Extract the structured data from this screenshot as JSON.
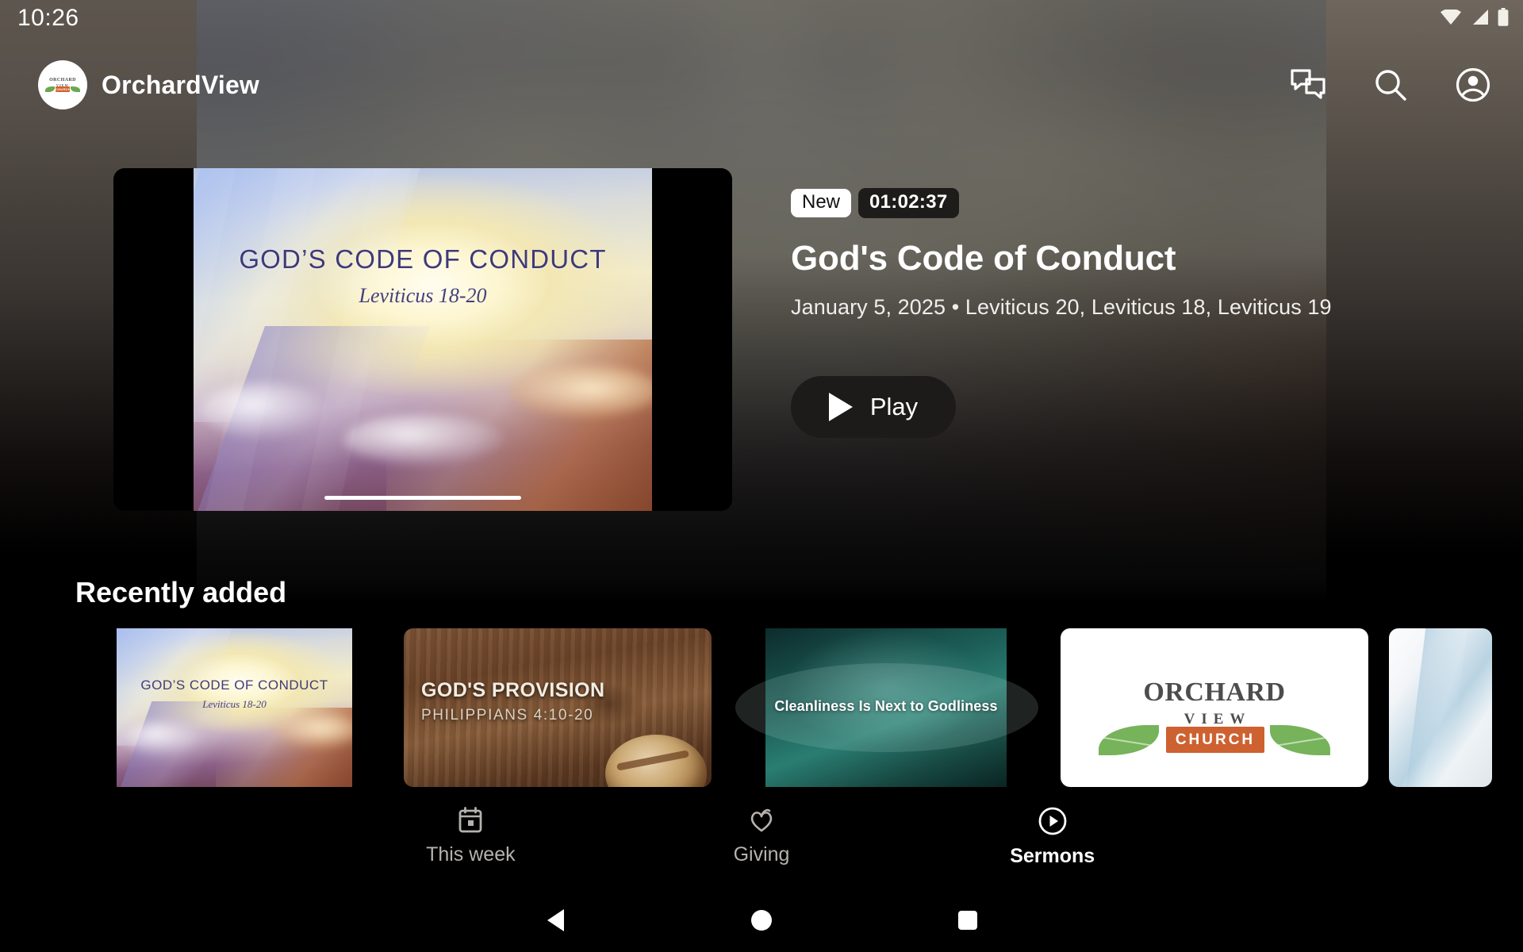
{
  "status_bar": {
    "time": "10:26",
    "icons": [
      "wifi-icon",
      "cellular-signal-icon",
      "battery-icon"
    ]
  },
  "app_bar": {
    "brand_name": "OrchardView",
    "avatar_icon": "church-logo-avatar",
    "actions": [
      {
        "icon": "chat-bubbles-icon",
        "name": "messages-button"
      },
      {
        "icon": "search-icon",
        "name": "search-button"
      },
      {
        "icon": "account-circle-icon",
        "name": "account-button"
      }
    ]
  },
  "hero": {
    "artwork": {
      "title": "GOD’S CODE OF CONDUCT",
      "reference": "Leviticus 18-20"
    },
    "badge_new": "New",
    "badge_duration": "01:02:37",
    "title": "God's Code of Conduct",
    "meta": "January 5, 2025 • Leviticus 20, Leviticus 18, Leviticus 19",
    "play_label": "Play",
    "play_icon": "play-triangle-icon"
  },
  "section": {
    "title": "Recently added",
    "cards": [
      {
        "kind": "code-of-conduct",
        "title": "GOD’S CODE OF CONDUCT",
        "reference": "Leviticus 18-20"
      },
      {
        "kind": "provision",
        "title": "GOD'S PROVISION",
        "reference": "PHILIPPIANS 4:10-20"
      },
      {
        "kind": "cleanliness",
        "title": "Cleanliness Is Next to Godliness",
        "reference": ""
      },
      {
        "kind": "church-logo",
        "logo_line1": "ORCHARD",
        "logo_line2": "VIEW",
        "logo_line3": "CHURCH"
      },
      {
        "kind": "partial-photo",
        "title": "",
        "reference": ""
      }
    ]
  },
  "bottom_nav": {
    "items": [
      {
        "label": "This week",
        "icon": "calendar-icon",
        "active": false
      },
      {
        "label": "Giving",
        "icon": "giving-ribbon-icon",
        "active": false
      },
      {
        "label": "Sermons",
        "icon": "play-circle-icon",
        "active": true
      }
    ]
  },
  "system_nav": {
    "back": "back-button",
    "home": "home-button",
    "recents": "recents-button"
  },
  "colors": {
    "accent_orange": "#cd6130",
    "leaf_green": "#76b35a",
    "logo_gray": "#4d4d4d",
    "badge_dark": "#1e1c1a",
    "page_black": "#000000"
  }
}
